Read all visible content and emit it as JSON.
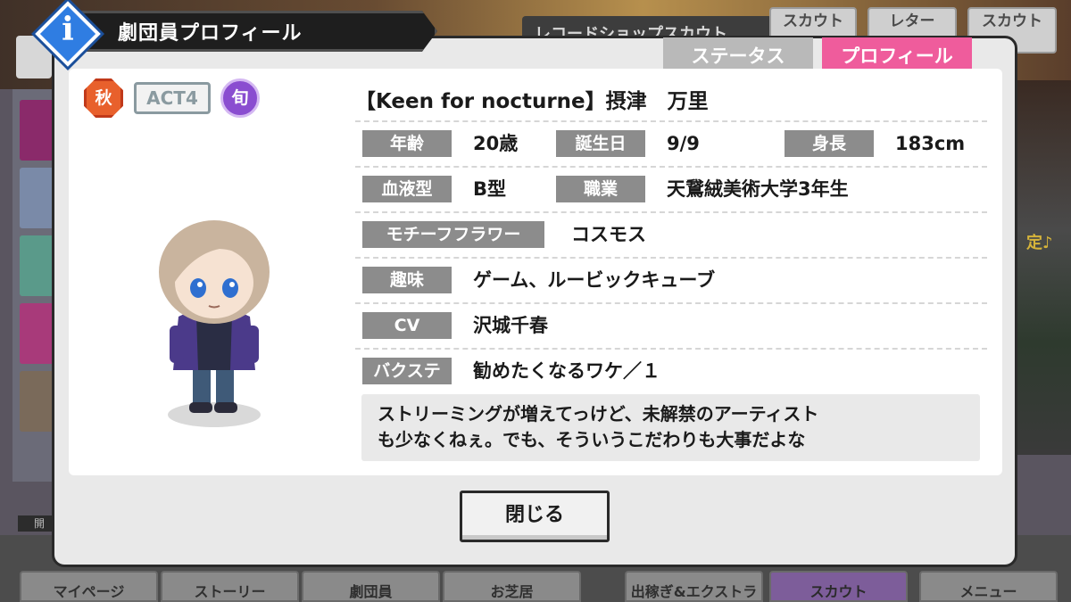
{
  "header": {
    "title": "劇団員プロフィール",
    "info_icon": "i"
  },
  "background": {
    "shop_title": "レコードショップスカウト",
    "top_buttons": [
      "スカウト",
      "レター",
      "スカウト"
    ],
    "right_text": "定♪",
    "nav_tag": "開",
    "nav_tabs": [
      "マイページ",
      "ストーリー",
      "劇団員",
      "お芝居",
      "出稼ぎ&エクストラ",
      "スカウト",
      "メニュー"
    ]
  },
  "tabs": {
    "status": "ステータス",
    "profile": "プロフィール"
  },
  "badges": {
    "season": "秋",
    "act": "ACT4",
    "shun": "旬"
  },
  "profile": {
    "name": "【Keen for nocturne】摂津　万里",
    "age_label": "年齢",
    "age": "20歳",
    "birthday_label": "誕生日",
    "birthday": "9/9",
    "height_label": "身長",
    "height": "183cm",
    "blood_label": "血液型",
    "blood": "B型",
    "job_label": "職業",
    "job": "天鵞絨美術大学3年生",
    "flower_label": "モチーフフラワー",
    "flower": "コスモス",
    "hobby_label": "趣味",
    "hobby": "ゲーム、ルービックキューブ",
    "cv_label": "CV",
    "cv": "沢城千春",
    "backstage_label": "バクステ",
    "backstage": "勧めたくなるワケ／１",
    "comment_line1": "ストリーミングが増えてっけど、未解禁のアーティスト",
    "comment_line2": "も少なくねぇ。でも、そういうこだわりも大事だよな"
  },
  "close_label": "閉じる",
  "colors": {
    "profile_tab": "#ef5c9c",
    "status_tab": "#b9b9b9",
    "label_bg": "#8c8c8c",
    "info_blue": "#2f7de2",
    "season_orange": "#e8602c",
    "shun_purple": "#8a4dd0"
  }
}
